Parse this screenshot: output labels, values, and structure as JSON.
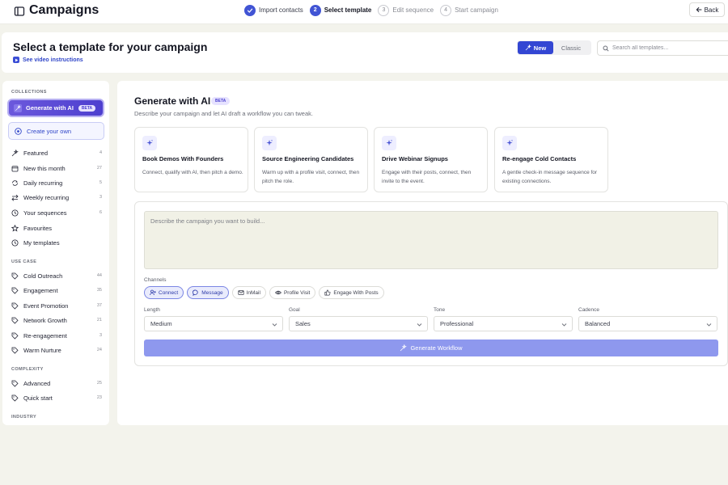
{
  "app": {
    "title": "Campaigns"
  },
  "steps": [
    {
      "num": "",
      "label": "Import contacts",
      "state": "done"
    },
    {
      "num": "2",
      "label": "Select template",
      "state": "active"
    },
    {
      "num": "3",
      "label": "Edit sequence",
      "state": "todo"
    },
    {
      "num": "4",
      "label": "Start campaign",
      "state": "todo"
    }
  ],
  "back_label": "Back",
  "header": {
    "title": "Select a template for your campaign",
    "video_link": "See video instructions",
    "toggle": {
      "new": "New",
      "classic": "Classic"
    },
    "search_placeholder": "Search all templates..."
  },
  "sidebar": {
    "collections_heading": "COLLECTIONS",
    "generate_ai": {
      "label": "Generate with AI",
      "badge": "BETA"
    },
    "create_own": "Create your own",
    "collections": [
      {
        "label": "Featured",
        "count": "4",
        "icon": "sparkle-icon"
      },
      {
        "label": "New this month",
        "count": "27",
        "icon": "calendar-icon"
      },
      {
        "label": "Daily recurring",
        "count": "5",
        "icon": "repeat-icon"
      },
      {
        "label": "Weekly recurring",
        "count": "3",
        "icon": "arrows-icon"
      },
      {
        "label": "Your sequences",
        "count": "6",
        "icon": "clock-icon"
      },
      {
        "label": "Favourites",
        "count": "",
        "icon": "star-icon"
      },
      {
        "label": "My templates",
        "count": "",
        "icon": "clock-icon"
      }
    ],
    "use_case_heading": "USE CASE",
    "use_cases": [
      {
        "label": "Cold Outreach",
        "count": "44"
      },
      {
        "label": "Engagement",
        "count": "35"
      },
      {
        "label": "Event Promotion",
        "count": "37"
      },
      {
        "label": "Network Growth",
        "count": "21"
      },
      {
        "label": "Re-engagement",
        "count": "3"
      },
      {
        "label": "Warm Nurture",
        "count": "24"
      }
    ],
    "complexity_heading": "COMPLEXITY",
    "complexity": [
      {
        "label": "Advanced",
        "count": "25"
      },
      {
        "label": "Quick start",
        "count": "23"
      }
    ],
    "industry_heading": "INDUSTRY"
  },
  "main": {
    "title": "Generate with AI",
    "badge": "BETA",
    "description": "Describe your campaign and let AI draft a workflow you can tweak.",
    "templates": [
      {
        "title": "Book Demos With Founders",
        "desc": "Connect, qualify with AI, then pitch a demo."
      },
      {
        "title": "Source Engineering Candidates",
        "desc": "Warm up with a profile visit, connect, then pitch the role."
      },
      {
        "title": "Drive Webinar Signups",
        "desc": "Engage with their posts, connect, then invite to the event."
      },
      {
        "title": "Re-engage Cold Contacts",
        "desc": "A gentle check-in message sequence for existing connections."
      }
    ],
    "prompt_placeholder": "Describe the campaign you want to build...",
    "channels_label": "Channels",
    "channels": [
      {
        "label": "Connect",
        "selected": true,
        "icon": "user-plus-icon"
      },
      {
        "label": "Message",
        "selected": true,
        "icon": "chat-bubble-icon"
      },
      {
        "label": "InMail",
        "selected": false,
        "icon": "mail-icon"
      },
      {
        "label": "Profile Visit",
        "selected": false,
        "icon": "eye-icon"
      },
      {
        "label": "Engage With Posts",
        "selected": false,
        "icon": "thumbs-up-icon"
      }
    ],
    "fields": [
      {
        "label": "Length",
        "value": "Medium"
      },
      {
        "label": "Goal",
        "value": "Sales"
      },
      {
        "label": "Tone",
        "value": "Professional"
      },
      {
        "label": "Cadence",
        "value": "Balanced"
      }
    ],
    "generate_button": "Generate Workflow"
  },
  "colors": {
    "accent": "#3346d3",
    "accent_purple": "#5a4bd6",
    "background": "#f3f3ec",
    "prompt_bg": "#f1f1e6",
    "generate_disabled": "#8e98ee"
  }
}
